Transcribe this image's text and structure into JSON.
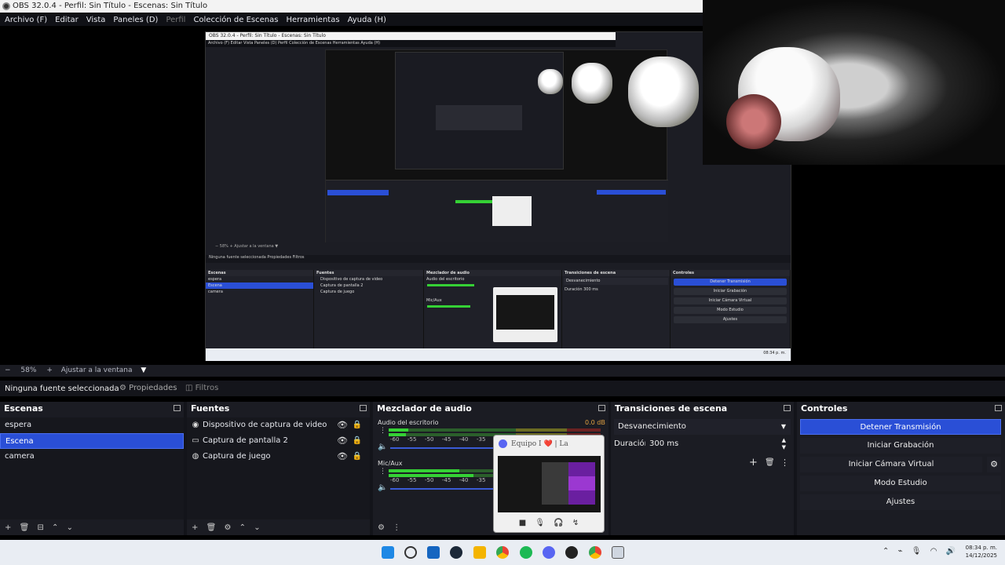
{
  "window": {
    "title": "OBS 32.0.4 - Perfil: Sin Título - Escenas: Sin Título"
  },
  "menu": [
    {
      "label": "Archivo (F)",
      "dim": false
    },
    {
      "label": "Editar",
      "dim": false
    },
    {
      "label": "Vista",
      "dim": false
    },
    {
      "label": "Paneles (D)",
      "dim": false
    },
    {
      "label": "Perfil",
      "dim": true
    },
    {
      "label": "Colección de Escenas",
      "dim": false
    },
    {
      "label": "Herramientas",
      "dim": false
    },
    {
      "label": "Ayuda (H)",
      "dim": false
    }
  ],
  "status_bar": {
    "minus": "−",
    "zoom": "58%",
    "plus": "+",
    "fit": "Ajustar a la ventana",
    "arrow": "▼"
  },
  "source_toolbar": {
    "no_source": "Ninguna fuente seleccionada",
    "properties": "Propiedades",
    "filters": "Filtros"
  },
  "scenes": {
    "title": "Escenas",
    "items": [
      "espera",
      "Escena",
      "camera"
    ],
    "selected_index": 1
  },
  "sources": {
    "title": "Fuentes",
    "items": [
      {
        "name": "Dispositivo de captura de video",
        "icon": "camera-icon"
      },
      {
        "name": "Captura de pantalla 2",
        "icon": "monitor-icon"
      },
      {
        "name": "Captura de juego",
        "icon": "gamepad-icon"
      }
    ]
  },
  "mixer": {
    "title": "Mezclador de audio",
    "channels": [
      {
        "name": "Audio del escritorio",
        "db": "0.0 dB"
      },
      {
        "name": "Mic/Aux",
        "db": ""
      }
    ],
    "ticks": [
      "-60",
      "-55",
      "-50",
      "-45",
      "-40",
      "-35"
    ]
  },
  "transitions": {
    "title": "Transiciones de escena",
    "selected": "Desvanecimiento",
    "duration_label": "Duración",
    "duration_value": "300 ms"
  },
  "controls": {
    "title": "Controles",
    "buttons": [
      "Detener Transmisión",
      "Iniciar Grabación",
      "Iniciar Cámara Virtual",
      "Modo Estudio",
      "Ajustes"
    ]
  },
  "popup": {
    "title": "Equipo I ❤️ | La cachondi..."
  },
  "clock": {
    "time": "08:34 p. m.",
    "date": "14/12/2025"
  },
  "nested": {
    "title": "OBS 32.0.4 - Perfil: Sin Título - Escenas: Sin Título",
    "menu": "Archivo (F)   Editar   Vista   Paneles (D)   Perfil   Colección de Escenas   Herramientas   Ayuda (H)",
    "status": "−  58%  +  Ajustar a la ventana ▼",
    "toolbar": "Ninguna fuente seleccionada     Propiedades     Filtros",
    "clock": "08:34 p. m."
  },
  "colors": {
    "accent": "#2a4fd6",
    "dock_bg": "#1b1c23",
    "meter_green": "#35d135"
  }
}
